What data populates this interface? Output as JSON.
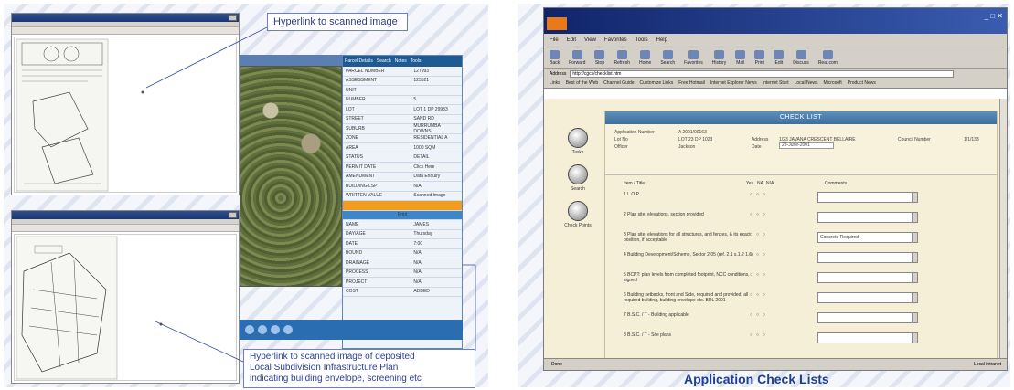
{
  "left": {
    "callout_top": "Hyperlink to scanned image",
    "callout_bottom_lines": [
      "Hyperlink to scanned image of deposited",
      "Local Subdivision Infrastructure Plan",
      "indicating building envelope, screening etc"
    ],
    "panel": {
      "tabs": [
        "Parcel Details",
        "Search",
        "Notes",
        "Tools"
      ],
      "rows": [
        {
          "k": "PARCEL NUMBER",
          "v": "127993"
        },
        {
          "k": "ASSESSMENT",
          "v": "123521"
        },
        {
          "k": "UNIT",
          "v": ""
        },
        {
          "k": "NUMBER",
          "v": "5"
        },
        {
          "k": "LOT",
          "v": "LOT 1 DP 29933"
        },
        {
          "k": "STREET",
          "v": "SAND RD"
        },
        {
          "k": "SUBURB",
          "v": "MURRUMBA DOWNS"
        },
        {
          "k": "ZONE",
          "v": "RESIDENTIAL A"
        },
        {
          "k": "AREA",
          "v": "1000 SQM"
        },
        {
          "k": "STATUS",
          "v": "DETAIL"
        },
        {
          "k": "PERMIT DATE",
          "v": "Click Here"
        },
        {
          "k": "AMENDMENT",
          "v": "Data Enquiry"
        },
        {
          "k": "BUILDING LSP",
          "v": "N/A"
        },
        {
          "k": "WRITTEN VALUE",
          "v": "Scanned Image"
        }
      ],
      "lower_rows": [
        {
          "k": "NAME",
          "v": "JAMES"
        },
        {
          "k": "DAY/AGE",
          "v": "Thursday"
        },
        {
          "k": "DATE",
          "v": "7:00"
        },
        {
          "k": "BOUND",
          "v": "N/A"
        },
        {
          "k": "DRAINAGE",
          "v": "N/A"
        },
        {
          "k": "PROCESS",
          "v": "N/A"
        },
        {
          "k": "PROJECT",
          "v": "N/A"
        },
        {
          "k": "COST",
          "v": "ADDED"
        }
      ],
      "highlight_label": "Print"
    }
  },
  "right": {
    "menu": [
      "File",
      "Edit",
      "View",
      "Favorites",
      "Tools",
      "Help"
    ],
    "toolbar": [
      "Back",
      "Forward",
      "Stop",
      "Refresh",
      "Home",
      "Search",
      "Favorites",
      "History",
      "Mail",
      "Print",
      "Edit",
      "Discuss",
      "Real.com"
    ],
    "address_label": "Address",
    "address_value": "http://cgcs/checklist.htm",
    "links_label": "Links",
    "links": [
      "Best of the Web",
      "Channel Guide",
      "Customize Links",
      "Free Hotmail",
      "Internet Explorer News",
      "Internet Start",
      "Local News",
      "Microsoft",
      "Product News"
    ],
    "side_buttons": [
      "Tasks",
      "Search",
      "Check Points"
    ],
    "checklist_title": "CHECK LIST",
    "info": {
      "app_label": "Application Number",
      "app_value": "A 2001/00163",
      "lot_label": "Lot No",
      "lot_value": "LOT 23 DP 1023",
      "officer_label": "Officer",
      "officer_value": "Jackson",
      "address_label": "Address",
      "address_value": "1/23 JAVANA CRESCENT BELLAIRE",
      "date_label": "Date",
      "date_value": "28-June-2001",
      "council_label": "Council Number",
      "council_value": "1/1/133"
    },
    "col_headers": [
      "Item / Title",
      "Yes",
      "NA",
      "N/A",
      "Comments"
    ],
    "rows": [
      {
        "q": "1  L.O.P.",
        "comment": ""
      },
      {
        "q": "2  Plan site, elevations, section provided",
        "comment": ""
      },
      {
        "q": "3  Plan site, elevations for all structures, and fences, & its exact position, if acceptable",
        "comment": "Concrete Required"
      },
      {
        "q": "4  Building Development/Scheme, Sector 2.05 (ref. 2.1 s.1.2 1.6)",
        "comment": ""
      },
      {
        "q": "5  BCPT: plan levels from completed footprint, NCC conditions, signed",
        "comment": ""
      },
      {
        "q": "6  Building setbacks, front and Side, required and provided, all required building, building envelope etc. BDL 2001",
        "comment": ""
      },
      {
        "q": "7  B.S.C. / T - Building applicable",
        "comment": ""
      },
      {
        "q": "8  B.S.C. / T - Site plans",
        "comment": ""
      }
    ],
    "status_left": "Done",
    "status_right": "Local intranet"
  },
  "caption": "Application Check Lists"
}
